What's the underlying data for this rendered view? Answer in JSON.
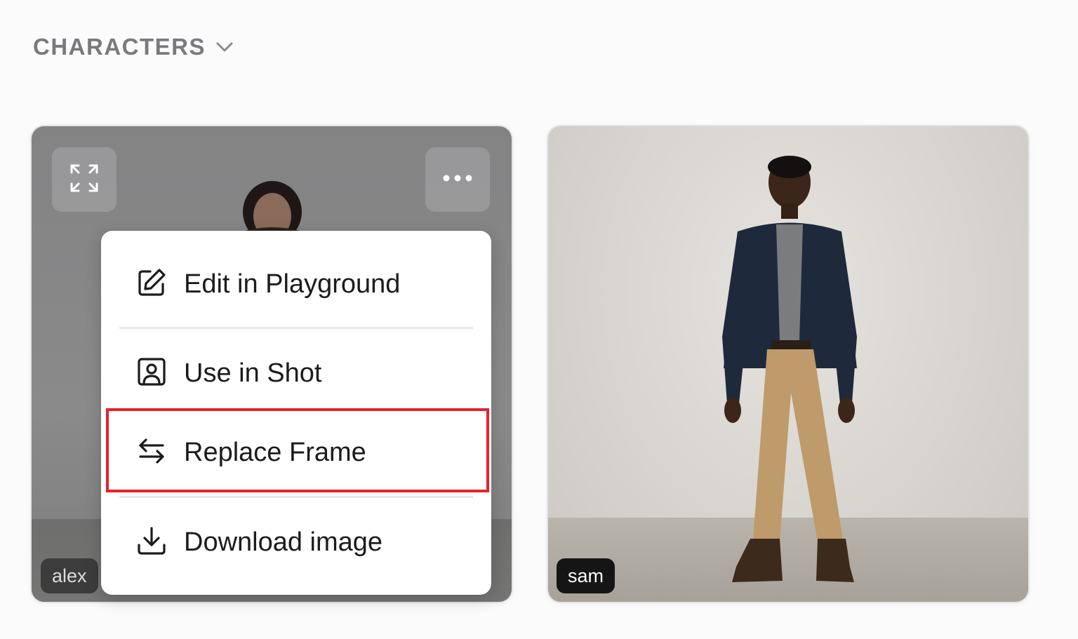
{
  "section": {
    "title": "CHARACTERS",
    "toggle_icon": "chevron-down-icon"
  },
  "cards": [
    {
      "name": "alex",
      "expand_icon": "expand-icon",
      "more_icon": "more-horizontal-icon"
    },
    {
      "name": "sam"
    }
  ],
  "menu": {
    "items": [
      {
        "label": "Edit in Playground",
        "icon": "edit-icon"
      },
      {
        "label": "Use in Shot",
        "icon": "portrait-icon"
      },
      {
        "label": "Replace Frame",
        "icon": "swap-arrows-icon"
      },
      {
        "label": "Download image",
        "icon": "download-icon"
      }
    ]
  },
  "colors": {
    "highlight": "#e5212b",
    "tag_bg": "#151515",
    "menu_bg": "#ffffff"
  }
}
